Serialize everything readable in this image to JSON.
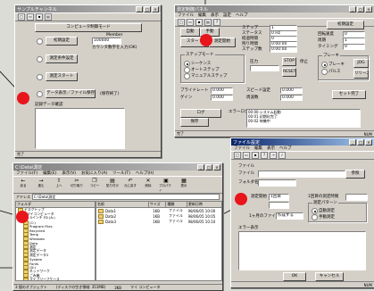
{
  "win1": {
    "title": "サンプルチャンネル",
    "header_button": "コンピュータ制御モード",
    "field_label": "Member",
    "field_value": "100000",
    "field_note": "カウンタ数字を入力(OK)",
    "buttons": [
      "初期設定",
      "測定条件設定",
      "測定スタート",
      "データ表示／ファイル保存"
    ],
    "button_note": "(保存終了)",
    "memo_label": "記録データ確認",
    "status": "完了"
  },
  "win2": {
    "title": "測定制御パネル",
    "menu": [
      "ファイル",
      "編集",
      "表示",
      "設定",
      "ヘルプ"
    ],
    "tabs": [
      "自動",
      "手動"
    ],
    "btn_start": "スタート",
    "btn_measure": "測定開始",
    "info_labels": [
      "ステップ",
      "ステータス",
      "経過時間",
      "残り時間",
      "ステップ数"
    ],
    "info_values": [
      "1",
      "0 Hz",
      "0",
      "0:00:00",
      "0:00:00"
    ],
    "side_labels": [
      "回転速度",
      "周期",
      "タイミング"
    ],
    "side_values": [
      "0",
      "1",
      "0"
    ],
    "right_btn": "初期設定",
    "step_mode_label": "ステップモード",
    "step_modes": [
      "シーケンス",
      "オートステップ",
      "マニュアルステップ"
    ],
    "pressure_label": "圧力",
    "stop_label": "停止",
    "mid_btns": [
      "STOP",
      "RESET"
    ],
    "break_label": "ブレーキ",
    "break_opts": [
      "ブレーキ",
      "パルス"
    ],
    "jog": "JOG",
    "release": "リリース",
    "param_labels": [
      "プライドレート",
      "ゲイン",
      "スピード設定",
      "周波数"
    ],
    "param_values": [
      "0.000",
      "0.000",
      "0.000",
      "0.000"
    ],
    "set_button": "セット完了",
    "log_label": "エラーログ",
    "log_lines": [
      "00:00 システム起動",
      "00:01 初期化完了",
      "00:02 待機中"
    ],
    "bottom_btns": [
      "ログ",
      "保存"
    ],
    "status": "完了",
    "status_right": "NUM"
  },
  "win3": {
    "title": "ファイル設定",
    "menu": [
      "ファイル",
      "編集",
      "表示",
      "ヘルプ"
    ],
    "file_label": "ファイル",
    "folder_label": "フォルダ名",
    "browse": "参照",
    "row_label": "測定開始",
    "row_label2": "1回目",
    "time_label": "1回目の測定時間",
    "spin_label": "1ヶ月のファイルを",
    "spin_value": "作成する",
    "radio_group_label": "測定パターン",
    "radios": [
      "自動測定",
      "手動測定"
    ],
    "memo_label": "エラー表示",
    "ok": "OK",
    "cancel": "キャンセル",
    "status": "NUM"
  },
  "win4": {
    "title": "C:\\Data\\測定",
    "menu": [
      "ファイル(F)",
      "編集(E)",
      "表示(V)",
      "お気に入り(A)",
      "ツール(T)",
      "ヘルプ(H)"
    ],
    "toolbar": [
      "戻る",
      "進む",
      "上へ",
      "切り取り",
      "コピー",
      "貼り付け",
      "元に戻す",
      "削除",
      "プロパティ",
      "表示"
    ],
    "address_label": "アドレス",
    "address": "C:\\Data\\測定",
    "tree_header": "フォルダ",
    "tree": [
      "デスクトップ",
      "マイコンピュータ",
      "3.5インチ FD (A:)",
      "(C:)",
      "Program Files",
      "Recycled",
      "Temp",
      "Windows",
      "Data",
      "測定",
      "測定データ",
      "測定データ2",
      "System",
      "Fonts",
      "(D:)",
      "ネットワーク",
      "ごみ箱",
      "マイブリーフケース"
    ],
    "cols": [
      "名前",
      "サイズ",
      "種類",
      "更新日時"
    ],
    "files": [
      {
        "name": "Data1",
        "size": "1KB",
        "type": "ファイル",
        "date": "98/06/05 10:00"
      },
      {
        "name": "Data2",
        "size": "1KB",
        "type": "ファイル",
        "date": "98/06/05 10:05"
      },
      {
        "name": "Data3",
        "size": "1KB",
        "type": "ファイル",
        "date": "98/06/05 10:10"
      }
    ],
    "status_left": "3 個のオブジェクト",
    "status_mid": "(ディスクの空き領域: 351MB)",
    "status_size": "3KB",
    "status_right": "マイ コンピュータ"
  },
  "colors": {
    "marker": "#e8161c",
    "titlebar": "#0a246a"
  }
}
